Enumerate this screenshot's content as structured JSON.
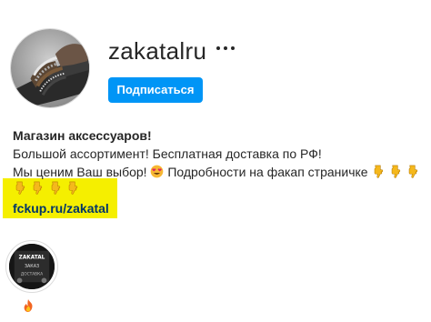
{
  "profile": {
    "username": "zakatalru",
    "more_icon": "more-horizontal-icon",
    "follow_label": "Подписаться",
    "accent_color": "#0095f6"
  },
  "bio": {
    "title": "Магазин аксессуаров!",
    "line1": "Большой ассортимент! Бесплатная доставка по РФ!",
    "line2_text": "Мы ценим Ваш выбор!",
    "line2_emoji": "smiling-face-with-heart-eyes",
    "line2_after": "Подробности на факап страничке",
    "line2_hands": [
      "backhand-index-pointing-down",
      "backhand-index-pointing-down",
      "backhand-index-pointing-down"
    ],
    "line3_hands": [
      "backhand-index-pointing-down",
      "backhand-index-pointing-down",
      "backhand-index-pointing-down",
      "backhand-index-pointing-down"
    ],
    "link": "fckup.ru/zakatal",
    "highlight_color": "#f5ef00"
  },
  "highlights": [
    {
      "label_emoji": "fire",
      "cover_text": [
        "ZAKATAL",
        "ЗАКАЗ",
        "ДОСТАВКА"
      ]
    }
  ]
}
